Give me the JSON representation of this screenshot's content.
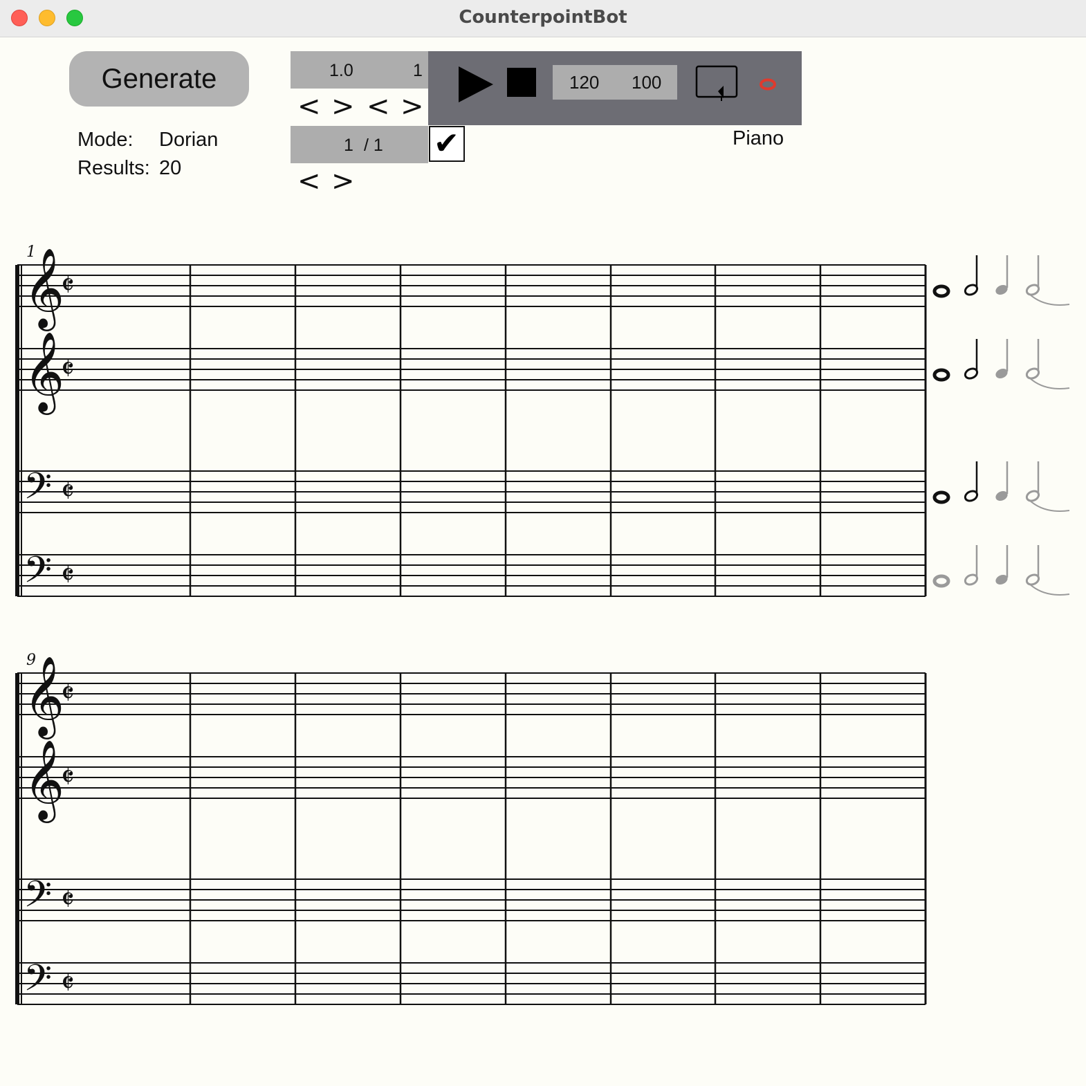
{
  "window": {
    "title": "CounterpointBot"
  },
  "toolbar": {
    "generate_label": "Generate",
    "mode_label": "Mode:",
    "mode_value": "Dorian",
    "results_label": "Results:",
    "results_value": "20"
  },
  "controls": {
    "duration_value": "1.0",
    "count_value": "1",
    "prev_symbol": "<",
    "next_symbol": ">",
    "result_index": "1",
    "result_total": "/ 1",
    "check_symbol": "✔"
  },
  "transport": {
    "tempo": "120",
    "volume": "100",
    "instrument": "Piano"
  },
  "score": {
    "systems": [
      {
        "measure_number": "1"
      },
      {
        "measure_number": "9"
      }
    ],
    "staves_per_system": 4,
    "measures_per_system": 8,
    "staff_clefs": [
      "treble",
      "treble",
      "bass",
      "bass"
    ],
    "time_signature": "𝄵",
    "clef_glyphs": {
      "treble": "𝄞",
      "bass": "𝄢"
    },
    "palette_rows": [
      [
        "black",
        "black",
        "gray",
        "gray"
      ],
      [
        "black",
        "black",
        "gray",
        "gray"
      ],
      [
        "black",
        "black",
        "gray",
        "gray"
      ],
      [
        "gray",
        "gray",
        "gray",
        "gray"
      ]
    ],
    "colors": {
      "line": "#111111",
      "active": "#111111",
      "inactive": "#9a9a9a"
    }
  }
}
